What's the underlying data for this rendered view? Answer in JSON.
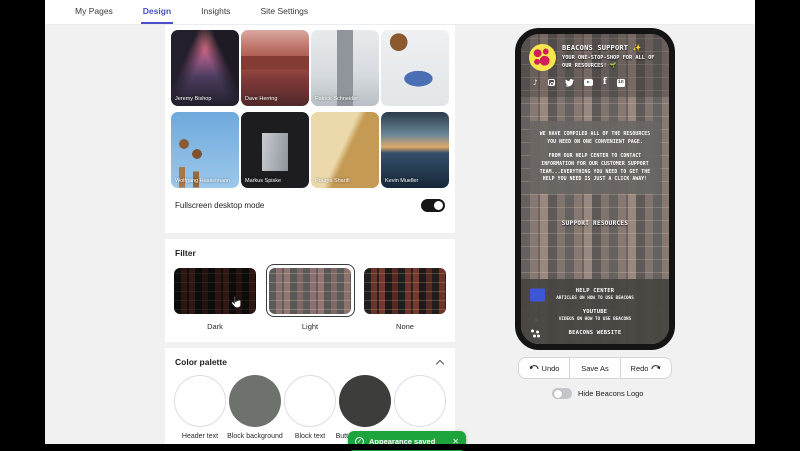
{
  "nav": {
    "tabs": [
      {
        "label": "My Pages"
      },
      {
        "label": "Design"
      },
      {
        "label": "Insights"
      },
      {
        "label": "Site Settings"
      }
    ],
    "accent_color": "#4a50c5"
  },
  "backgrounds": {
    "items": [
      {
        "name": "Jeremy Bishop"
      },
      {
        "name": "Dave Herring"
      },
      {
        "name": "Patrick Schneider"
      },
      {
        "name": ""
      },
      {
        "name": "Wolfgang Hasselmann"
      },
      {
        "name": "Markus Spiske"
      },
      {
        "name": "Pourya Sharifi"
      },
      {
        "name": "Kevin Mueller"
      }
    ]
  },
  "fullscreen": {
    "label": "Fullscreen desktop mode",
    "enabled": true
  },
  "filter": {
    "title": "Filter",
    "options": [
      {
        "label": "Dark",
        "selected": false
      },
      {
        "label": "Light",
        "selected": true
      },
      {
        "label": "None",
        "selected": false
      }
    ]
  },
  "palette": {
    "title": "Color palette",
    "swatches": [
      {
        "label": "Header text",
        "color": "#ffffff"
      },
      {
        "label": "Block background",
        "color": "#6e726d"
      },
      {
        "label": "Block text",
        "color": "#ffffff"
      },
      {
        "label": "Button background",
        "color": "#3d3d3c"
      },
      {
        "label": "",
        "color": "#ffffff"
      }
    ]
  },
  "phone": {
    "title": "BEACONS SUPPORT ✨",
    "subtitle": "YOUR ONE-STOP-SHOP FOR ALL OF OUR RESOURCES! 🌱",
    "social_icons": [
      "tiktok",
      "instagram",
      "twitter",
      "youtube",
      "facebook",
      "linkedin"
    ],
    "intro_1": "WE HAVE COMPILED ALL OF THE RESOURCES YOU NEED ON ONE CONVENIENT PAGE.",
    "intro_2": "FROM OUR HELP CENTER TO CONTACT INFORMATION FOR OUR CUSTOMER SUPPORT TEAM...EVERYTHING YOU NEED TO GET THE HELP YOU NEED IS JUST A CLICK AWAY!",
    "section_title": "SUPPORT RESOURCES",
    "links": [
      {
        "title": "HELP CENTER",
        "subtitle": "ARTICLES ON HOW TO USE BEACONS"
      },
      {
        "title": "YOUTUBE",
        "subtitle": "VIDEOS ON HOW TO USE BEACONS"
      },
      {
        "title": "BEACONS WEBSITE",
        "subtitle": ""
      }
    ],
    "help_icon_color": "#3c56d6"
  },
  "controls": {
    "undo": "Undo",
    "save_as": "Save As",
    "redo": "Redo",
    "hide_logo_label": "Hide Beacons Logo",
    "hide_logo_enabled": false
  },
  "toast": {
    "message": "Appearance saved",
    "color": "#1ea43c"
  }
}
